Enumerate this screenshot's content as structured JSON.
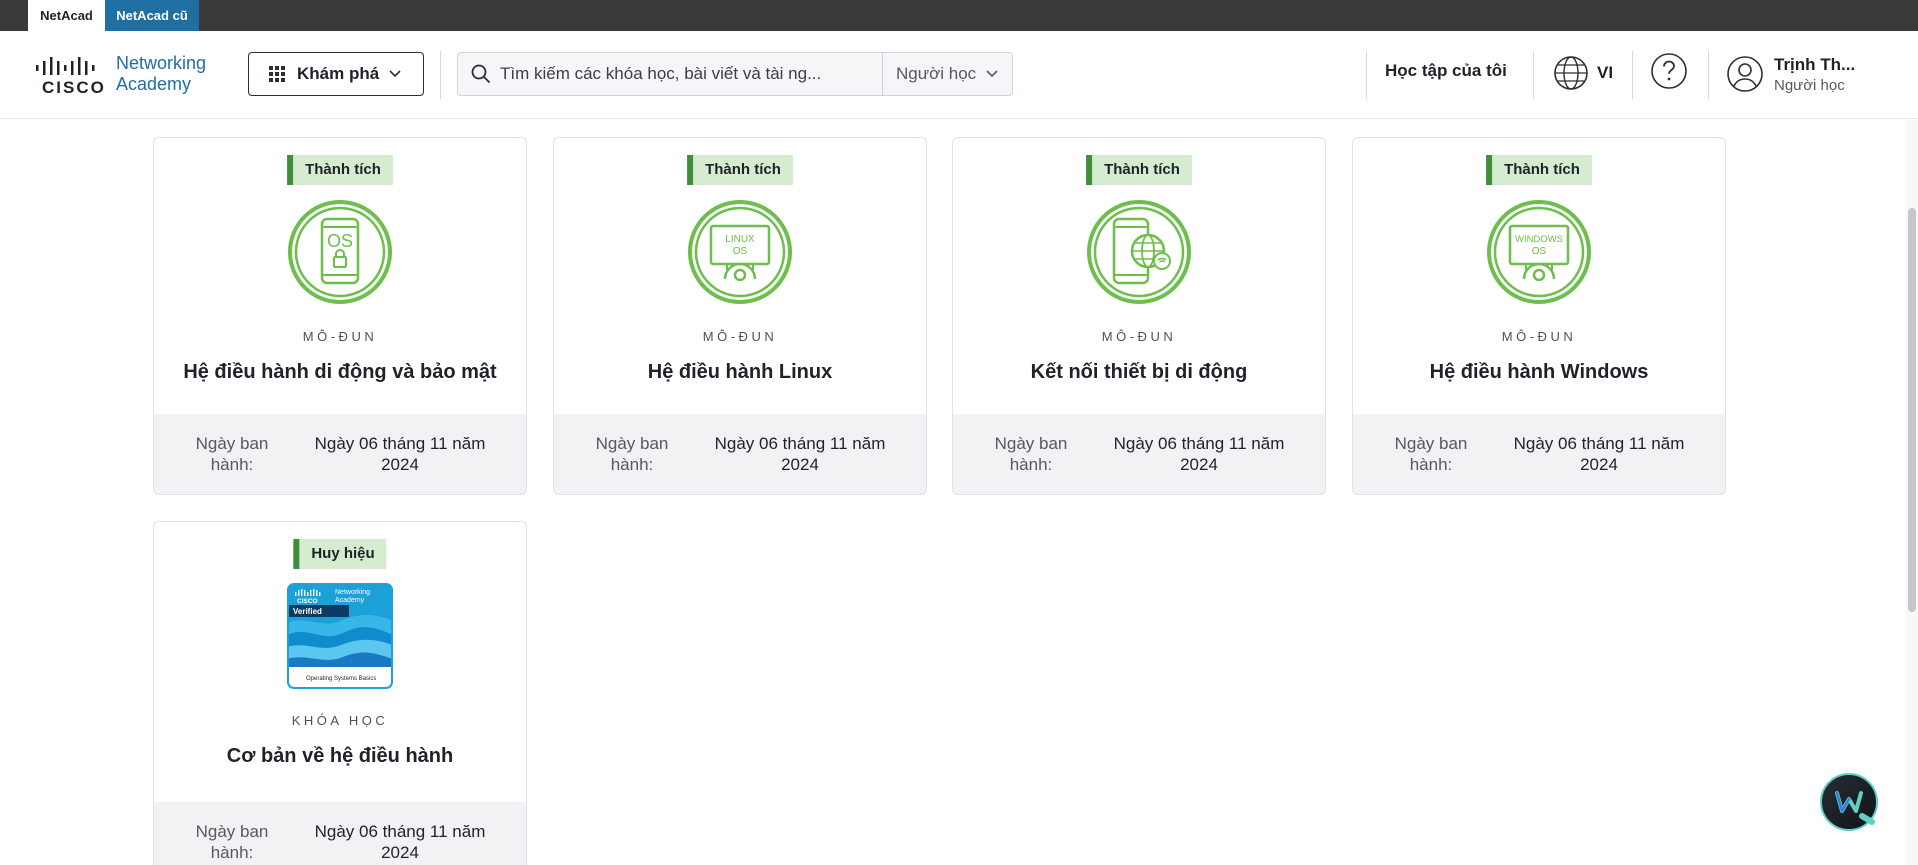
{
  "top_strip": {
    "tabs": [
      {
        "label": "NetAcad",
        "active": true
      },
      {
        "label": "NetAcad cũ",
        "active": false
      }
    ]
  },
  "header": {
    "logo": {
      "brand": "CISCO",
      "line1": "Networking",
      "line2": "Academy"
    },
    "explore_label": "Khám phá",
    "search": {
      "placeholder": "Tìm kiếm các khóa học, bài viết và tài ng..."
    },
    "role_select": {
      "value": "Người học"
    },
    "my_learning_label": "Học tập của tôi",
    "language_label": "VI",
    "user": {
      "name": "Trịnh Th...",
      "role": "Người học"
    }
  },
  "cards": [
    {
      "tag": "Thành tích",
      "icon": "mobile-os-security-badge-icon",
      "type": "MÔ-ĐUN",
      "title": "Hệ điều hành di động và bảo mật",
      "date_label": "Ngày ban hành:",
      "date_value": "Ngày 06 tháng 11 năm 2024"
    },
    {
      "tag": "Thành tích",
      "icon": "linux-os-badge-icon",
      "type": "MÔ-ĐUN",
      "title": "Hệ điều hành Linux",
      "date_label": "Ngày ban hành:",
      "date_value": "Ngày 06 tháng 11 năm 2024",
      "badge_text": "LINUX OS"
    },
    {
      "tag": "Thành tích",
      "icon": "mobile-connectivity-badge-icon",
      "type": "MÔ-ĐUN",
      "title": "Kết nối thiết bị di động",
      "date_label": "Ngày ban hành:",
      "date_value": "Ngày 06 tháng 11 năm 2024"
    },
    {
      "tag": "Thành tích",
      "icon": "windows-os-badge-icon",
      "type": "MÔ-ĐUN",
      "title": "Hệ điều hành Windows",
      "date_label": "Ngày ban hành:",
      "date_value": "Ngày 06 tháng 11 năm 2024",
      "badge_text": "WINDOWS OS"
    },
    {
      "tag": "Huy hiệu",
      "icon": "course-verified-badge-icon",
      "type": "KHÓA HỌC",
      "title": "Cơ bản về hệ điều hành",
      "date_label": "Ngày ban hành:",
      "date_value": "Ngày 06 tháng 11 năm 2024",
      "badge": {
        "brand": "CISCO",
        "academy": "Networking Academy",
        "verified": "Verified",
        "course": "Operating Systems Basics"
      }
    }
  ],
  "badge_texts": {
    "os": "OS"
  },
  "colors": {
    "accent_green": "#6cbf4a",
    "tag_bar": "#3f8e3a",
    "tag_bg": "#d5ecd0",
    "link_blue": "#1f6fa3"
  }
}
